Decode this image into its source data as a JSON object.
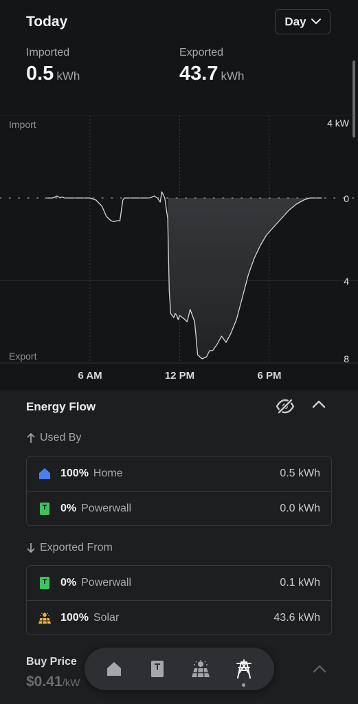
{
  "header": {
    "title": "Today",
    "period_select": {
      "value": "Day"
    }
  },
  "stats": {
    "imported": {
      "label": "Imported",
      "value": "0.5",
      "unit": "kWh"
    },
    "exported": {
      "label": "Exported",
      "value": "43.7",
      "unit": "kWh"
    }
  },
  "chart_data": {
    "type": "area",
    "top_label": "Import",
    "bottom_label": "Export",
    "y_unit_label": "4 kW",
    "y_ticks": [
      "4 kW",
      "0",
      "4",
      "8"
    ],
    "x_ticks": [
      "6 AM",
      "12 PM",
      "6 PM"
    ],
    "ylim": [
      -8,
      4
    ],
    "xlim": [
      0,
      24
    ],
    "grid": true,
    "series": [
      {
        "x": [
          3.0,
          3.5,
          3.8,
          4.0,
          4.1,
          4.3,
          4.8,
          5.2,
          5.6,
          6.0,
          6.4,
          6.8,
          7.1,
          7.4,
          7.6,
          7.8,
          8.0,
          8.2,
          8.3,
          8.4,
          8.5,
          8.5,
          9.0,
          9.5,
          10.0,
          10.3,
          10.5,
          10.7,
          10.8,
          11.0,
          11.1,
          11.2,
          11.3,
          11.4,
          11.5,
          11.6,
          11.7,
          11.8,
          11.9,
          12.0,
          12.2,
          12.5,
          12.7,
          13.0,
          13.2,
          13.5,
          13.8,
          14.0,
          14.2,
          14.5,
          14.8,
          15.1,
          15.4,
          15.8,
          16.2,
          16.6,
          17.0,
          17.4,
          17.8,
          18.3,
          18.8,
          19.3,
          19.8,
          20.3,
          20.7,
          21.0,
          21.5
        ],
        "y": [
          0,
          0,
          0.1,
          0,
          0.05,
          0,
          0,
          0,
          0,
          0,
          -0.1,
          -0.4,
          -0.9,
          -1.1,
          -1.15,
          -1.1,
          -1.1,
          -0.1,
          0,
          0,
          0,
          0,
          0,
          0,
          0,
          0.1,
          0,
          -0.2,
          0.3,
          0,
          -0.5,
          -1.0,
          -4.5,
          -5.6,
          -5.7,
          -5.8,
          -5.6,
          -5.7,
          -5.9,
          -5.7,
          -5.8,
          -6.0,
          -5.4,
          -6.0,
          -7.6,
          -7.8,
          -7.7,
          -7.4,
          -7.4,
          -7.1,
          -6.7,
          -7.0,
          -6.6,
          -5.9,
          -4.8,
          -3.7,
          -2.9,
          -2.3,
          -1.8,
          -1.4,
          -1.0,
          -0.6,
          -0.3,
          -0.1,
          0,
          0,
          0
        ]
      }
    ]
  },
  "energy_flow": {
    "title": "Energy Flow",
    "used_by": {
      "label": "Used By",
      "rows": [
        {
          "icon": "home-icon",
          "pct": "100%",
          "name": "Home",
          "value": "0.5 kWh"
        },
        {
          "icon": "powerwall-icon",
          "pct": "0%",
          "name": "Powerwall",
          "value": "0.0 kWh"
        }
      ]
    },
    "exported_from": {
      "label": "Exported From",
      "rows": [
        {
          "icon": "powerwall-icon",
          "pct": "0%",
          "name": "Powerwall",
          "value": "0.1 kWh"
        },
        {
          "icon": "solar-icon",
          "pct": "100%",
          "name": "Solar",
          "value": "43.6 kWh"
        }
      ]
    }
  },
  "buy_price": {
    "label": "Buy Price",
    "value": "$0.41",
    "unit": "/kW"
  },
  "tab_bar": {
    "tabs": [
      "home-tab",
      "powerwall-tab",
      "solar-tab",
      "grid-tab"
    ],
    "active": "grid-tab"
  },
  "colors": {
    "home_icon": "#4a7df0",
    "powerwall_icon": "#3ec45e",
    "solar_icon": "#f4b63f"
  }
}
